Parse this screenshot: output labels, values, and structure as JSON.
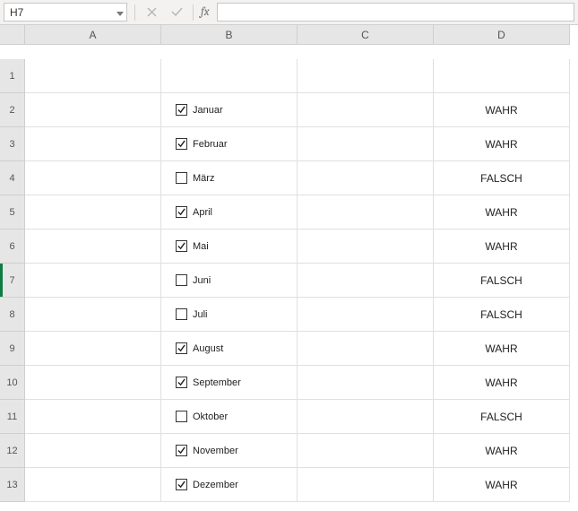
{
  "formula_bar": {
    "name_box_value": "H7",
    "cancel_tip": "Cancel",
    "confirm_tip": "Enter",
    "fx_label": "fx",
    "formula_value": ""
  },
  "columns": [
    "A",
    "B",
    "C",
    "D"
  ],
  "selected_row": 7,
  "rows": [
    {
      "n": 1,
      "checkbox": null,
      "d": ""
    },
    {
      "n": 2,
      "checkbox": {
        "label": "Januar",
        "checked": true
      },
      "d": "WAHR"
    },
    {
      "n": 3,
      "checkbox": {
        "label": "Februar",
        "checked": true
      },
      "d": "WAHR"
    },
    {
      "n": 4,
      "checkbox": {
        "label": "März",
        "checked": false
      },
      "d": "FALSCH"
    },
    {
      "n": 5,
      "checkbox": {
        "label": "April",
        "checked": true
      },
      "d": "WAHR"
    },
    {
      "n": 6,
      "checkbox": {
        "label": "Mai",
        "checked": true
      },
      "d": "WAHR"
    },
    {
      "n": 7,
      "checkbox": {
        "label": "Juni",
        "checked": false
      },
      "d": "FALSCH"
    },
    {
      "n": 8,
      "checkbox": {
        "label": "Juli",
        "checked": false
      },
      "d": "FALSCH"
    },
    {
      "n": 9,
      "checkbox": {
        "label": "August",
        "checked": true
      },
      "d": "WAHR"
    },
    {
      "n": 10,
      "checkbox": {
        "label": "September",
        "checked": true
      },
      "d": "WAHR"
    },
    {
      "n": 11,
      "checkbox": {
        "label": "Oktober",
        "checked": false
      },
      "d": "FALSCH"
    },
    {
      "n": 12,
      "checkbox": {
        "label": "November",
        "checked": true
      },
      "d": "WAHR"
    },
    {
      "n": 13,
      "checkbox": {
        "label": "Dezember",
        "checked": true
      },
      "d": "WAHR"
    }
  ]
}
